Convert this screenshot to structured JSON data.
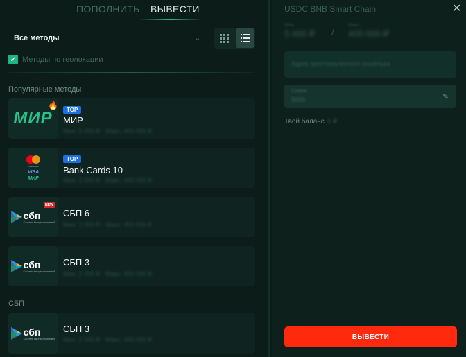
{
  "tabs": {
    "deposit": "ПОПОЛНИТЬ",
    "withdraw": "ВЫВЕСТИ"
  },
  "filter": {
    "selected": "Все методы",
    "chevron_icon": "chevron-down-icon"
  },
  "view_toggle": {
    "grid_icon": "grid-icon",
    "list_icon": "list-icon",
    "active": "list"
  },
  "geo_filter": {
    "label": "Методы по геолокации",
    "checked": true
  },
  "sections": {
    "popular": "Популярные методы",
    "sbp": "СБП"
  },
  "methods": [
    {
      "name": "МИР",
      "badge": "TOP",
      "logo": "МИР",
      "limits": "Мин: 5 000 ₽ · Макс: 400 000 ₽"
    },
    {
      "name": "Bank Cards 10",
      "badge": "TOP",
      "limits": "Мин: 2 000 ₽ · Макс: 400 000 ₽"
    },
    {
      "name": "СБП 6",
      "new_tag": "NEW",
      "limits": "Мин: 2 000 ₽ · Макс: 400 000 ₽"
    },
    {
      "name": "СБП 3",
      "limits": "Мин: 2 000 ₽ · Макс: 400 000 ₽"
    },
    {
      "name": "СБП 3",
      "limits": "Мин: 2 000 ₽ · Макс: 400 000 ₽"
    }
  ],
  "logos": {
    "sbp_text": "сбп",
    "sbp_sub": "Система быстрых платежей",
    "mastercard_text": "mastercard",
    "visa_text": "VISA",
    "mir_small": "МИР"
  },
  "right_panel": {
    "title": "USDC BNB Smart Chain",
    "min_label": "Мин.",
    "min_value": "5 000 ₽",
    "max_label": "Макс.",
    "max_value": "400 000 ₽",
    "address_placeholder": "Адрес криптовалютного кошелька",
    "amount_label": "Сумма",
    "amount_value": "5000",
    "balance_label": "Твой баланс",
    "balance_value": "0 ₽",
    "submit": "ВЫВЕСТИ"
  },
  "colors": {
    "accent_green": "#1fb582",
    "badge_blue": "#1b6fe0",
    "button_red": "#ff2a0e"
  }
}
